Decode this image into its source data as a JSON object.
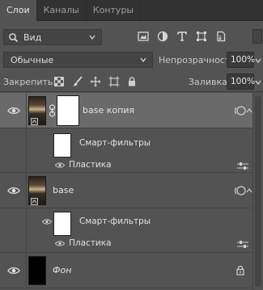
{
  "tabs": [
    {
      "label": "Слои",
      "active": true
    },
    {
      "label": "Каналы",
      "active": false
    },
    {
      "label": "Контуры",
      "active": false
    }
  ],
  "filter": {
    "kind_label": "Вид",
    "icons": [
      "image-filter-icon",
      "adjustment-filter-icon",
      "type-filter-icon",
      "shape-filter-icon",
      "smart-object-filter-icon"
    ]
  },
  "blend": {
    "mode": "Обычные",
    "opacity_label": "Непрозрачность:",
    "opacity_value": "100%"
  },
  "lock": {
    "label": "Закрепить:",
    "icons": [
      "lock-transparent-pixels-icon",
      "lock-image-pixels-icon",
      "lock-position-icon",
      "lock-artboard-icon",
      "lock-all-icon"
    ],
    "fill_label": "Заливка:",
    "fill_value": "100%"
  },
  "layers": {
    "base_copy": {
      "name": "base копия",
      "smart_filters_label": "Смарт-фильтры",
      "filter_name": "Пластика"
    },
    "base": {
      "name": "base",
      "smart_filters_label": "Смарт-фильтры",
      "filter_name": "Пластика"
    },
    "background": {
      "name": "Фон"
    }
  },
  "colors": {
    "panel": "#535353",
    "tab_bar": "#323232",
    "selected_row": "#6a6a6a"
  }
}
